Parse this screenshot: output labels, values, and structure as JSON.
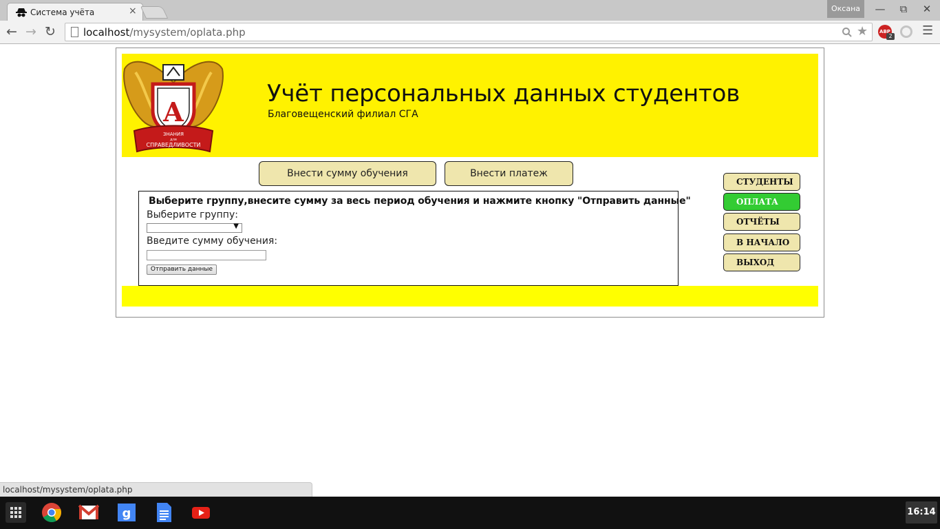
{
  "browser": {
    "tab_title": "Система учёта",
    "tab_close": "×",
    "profile_name": "Оксана",
    "url_host": "localhost",
    "url_path": "/mysystem/oplata.php",
    "back": "←",
    "forward": "→",
    "reload": "↻",
    "minimize": "—",
    "restore": "⧉",
    "close": "✕",
    "abp_label": "ABP",
    "abp_count": "2"
  },
  "header": {
    "title": "Учёт персональных данных студентов",
    "subtitle": "Благовещенский филиал СГА",
    "logo_letter": "А",
    "logo_ribbon_top": "ЗНАНИЯ",
    "logo_ribbon_mid": "для",
    "logo_ribbon_bottom": "СПРАВЕДЛИВОСТИ"
  },
  "top_buttons": {
    "enter_sum": "Внести сумму обучения",
    "enter_payment": "Внести платеж"
  },
  "form": {
    "heading": "Выберите группу,внесите сумму за весь период обучения и нажмите кнопку \"Отправить данные\"",
    "group_label": "Выберите группу:",
    "group_selected": "",
    "sum_label": "Введите сумму обучения:",
    "sum_value": "",
    "submit_label": "Отправить данные"
  },
  "side_menu": {
    "items": [
      {
        "label": "СТУДЕНТЫ",
        "active": false
      },
      {
        "label": "ОПЛАТА",
        "active": true
      },
      {
        "label": "ОТЧЁТЫ",
        "active": false
      },
      {
        "label": "В НАЧАЛО",
        "active": false
      },
      {
        "label": "ВЫХОД",
        "active": false
      }
    ]
  },
  "status_bar": {
    "hover_url": "localhost/mysystem/oplata.php"
  },
  "shelf": {
    "clock": "16:14",
    "apps": [
      "app-launcher-icon",
      "chrome-icon",
      "gmail-icon",
      "google-search-icon",
      "docs-icon",
      "youtube-icon"
    ]
  },
  "colors": {
    "header_bg": "#fff200",
    "footer_bg": "#ffff00",
    "button_bg": "#efe6ad",
    "active_menu_bg": "#33cc33"
  }
}
